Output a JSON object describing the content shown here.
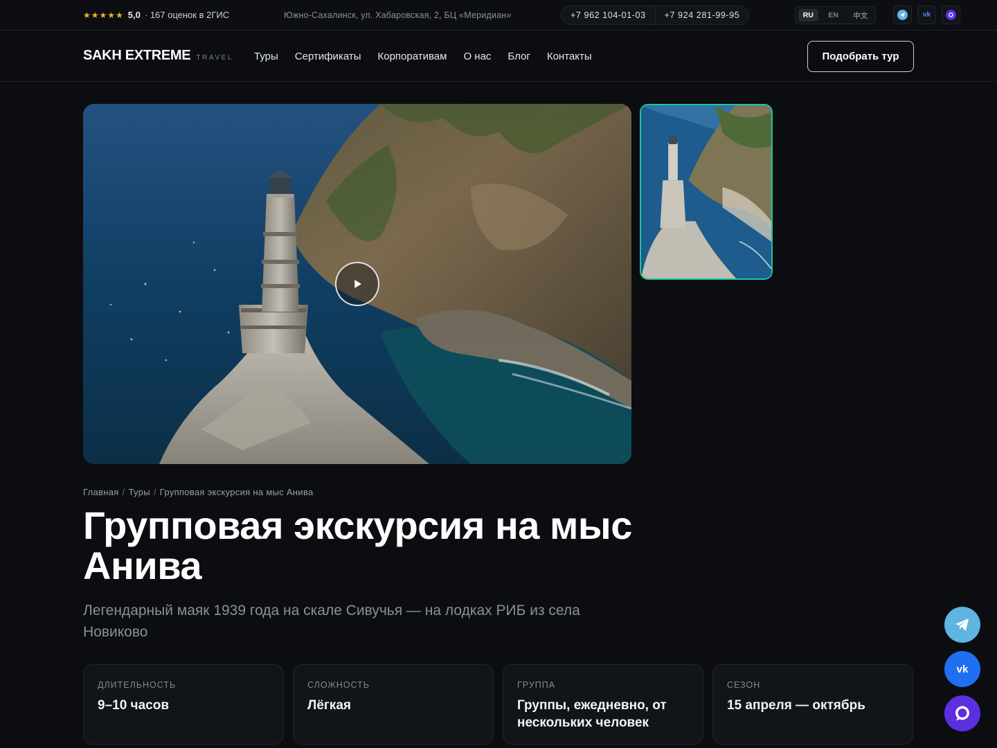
{
  "topbar": {
    "stars": "★★★★★",
    "rating": "5,0",
    "reviews": "· 167 оценок в 2ГИС",
    "address": "Южно-Сахалинск, ул. Хабаровская, 2, БЦ «Меридиан»",
    "phones": [
      "+7 962 104-01-03",
      "+7 924 281-99-95"
    ],
    "languages": [
      "RU",
      "EN",
      "中文"
    ],
    "active_language": "RU",
    "vk_label": "vk"
  },
  "nav": {
    "logo_main": "SAKH EXTREME",
    "logo_sub": "TRAVEL",
    "menu": [
      "Туры",
      "Сертификаты",
      "Корпоративам",
      "О нас",
      "Блог",
      "Контакты"
    ],
    "cta": "Подобрать тур"
  },
  "breadcrumb": [
    "Главная",
    "Туры",
    "Групповая экскурсия на мыс Анива"
  ],
  "breadcrumb_sep": "/",
  "title": "Групповая экскурсия на мыс Анива",
  "subtitle": "Легендарный маяк 1939 года на скале Сивучья — на лодках РИБ из села Новиково",
  "cards": [
    {
      "label": "Длительность",
      "value": "9–10 часов"
    },
    {
      "label": "Сложность",
      "value": "Лёгкая"
    },
    {
      "label": "Группа",
      "value": "Группы, ежедневно, от нескольких человек"
    },
    {
      "label": "Сезон",
      "value": "15 апреля — октябрь"
    }
  ],
  "floating": {
    "vk_label": "vk"
  },
  "colors": {
    "accent_border": "#22c49a",
    "telegram": "#5fb4e2",
    "vk": "#1f6ff0",
    "max": "#5b2fe0",
    "stars": "#f2b234"
  }
}
